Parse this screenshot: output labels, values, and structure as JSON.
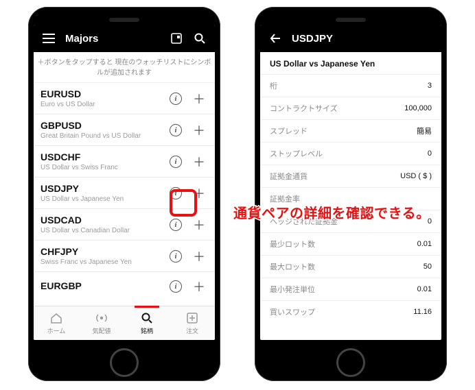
{
  "left": {
    "header": {
      "title": "Majors"
    },
    "hint": "＋ボタンをタップすると 現在のウォッチリストにシンボルが追加されます",
    "pairs": [
      {
        "symbol": "EURUSD",
        "desc": "Euro vs US Dollar"
      },
      {
        "symbol": "GBPUSD",
        "desc": "Great Britain Pound vs US Dollar"
      },
      {
        "symbol": "USDCHF",
        "desc": "US Dollar vs Swiss Franc"
      },
      {
        "symbol": "USDJPY",
        "desc": "US Dollar vs Japanese Yen"
      },
      {
        "symbol": "USDCAD",
        "desc": "US Dollar vs Canadian Dollar"
      },
      {
        "symbol": "CHFJPY",
        "desc": "Swiss Franc vs Japanese Yen"
      },
      {
        "symbol": "EURGBP",
        "desc": ""
      }
    ],
    "tabs": [
      {
        "label": "ホーム"
      },
      {
        "label": "気配値"
      },
      {
        "label": "銘柄"
      },
      {
        "label": "注文"
      }
    ]
  },
  "right": {
    "header": {
      "title": "USDJPY"
    },
    "subtitle": "US Dollar vs Japanese Yen",
    "rows": [
      {
        "label": "桁",
        "value": "3"
      },
      {
        "label": "コントラクトサイズ",
        "value": "100,000"
      },
      {
        "label": "スプレッド",
        "value": "簡易"
      },
      {
        "label": "ストップレベル",
        "value": "0"
      },
      {
        "label": "証拠金通貨",
        "value": "USD ( $ )"
      },
      {
        "label": "証拠金率",
        "value": ""
      },
      {
        "label": "ヘッジされた証拠金",
        "value": "0"
      },
      {
        "label": "最少ロット数",
        "value": "0.01"
      },
      {
        "label": "最大ロット数",
        "value": "50"
      },
      {
        "label": "最小発注単位",
        "value": "0.01"
      },
      {
        "label": "買いスワップ",
        "value": "11.16"
      }
    ]
  },
  "annotation": "通貨ペアの詳細を確認できる。"
}
